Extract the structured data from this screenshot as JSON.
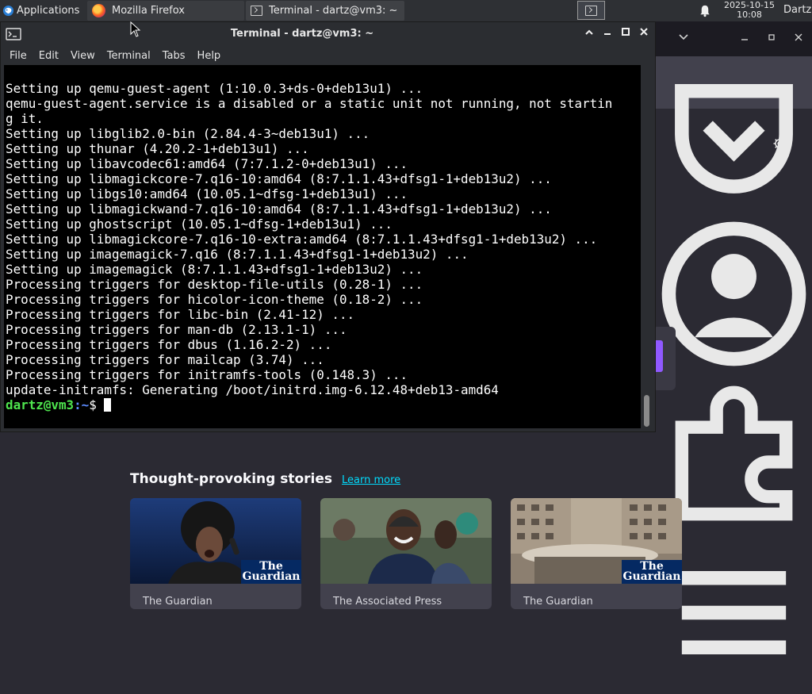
{
  "panel": {
    "applications_label": "Applications",
    "tasks": [
      {
        "label": "Mozilla Firefox",
        "icon": "firefox-icon"
      },
      {
        "label": "Terminal - dartz@vm3: ~",
        "icon": "terminal-icon"
      }
    ],
    "clock_date": "2025-10-15",
    "clock_time": "10:08",
    "user": "Dartz"
  },
  "terminal": {
    "title": "Terminal - dartz@vm3: ~",
    "menu": [
      "File",
      "Edit",
      "View",
      "Terminal",
      "Tabs",
      "Help"
    ],
    "output_lines": [
      "Setting up qemu-guest-agent (1:10.0.3+ds-0+deb13u1) ...",
      "qemu-guest-agent.service is a disabled or a static unit not running, not startin",
      "g it.",
      "Setting up libglib2.0-bin (2.84.4-3~deb13u1) ...",
      "Setting up thunar (4.20.2-1+deb13u1) ...",
      "Setting up libavcodec61:amd64 (7:7.1.2-0+deb13u1) ...",
      "Setting up libmagickcore-7.q16-10:amd64 (8:7.1.1.43+dfsg1-1+deb13u2) ...",
      "Setting up libgs10:amd64 (10.05.1~dfsg-1+deb13u1) ...",
      "Setting up libmagickwand-7.q16-10:amd64 (8:7.1.1.43+dfsg1-1+deb13u2) ...",
      "Setting up ghostscript (10.05.1~dfsg-1+deb13u1) ...",
      "Setting up libmagickcore-7.q16-10-extra:amd64 (8:7.1.1.43+dfsg1-1+deb13u2) ...",
      "Setting up imagemagick-7.q16 (8:7.1.1.43+dfsg1-1+deb13u2) ...",
      "Setting up imagemagick (8:7.1.1.43+dfsg1-1+deb13u2) ...",
      "Processing triggers for desktop-file-utils (0.28-1) ...",
      "Processing triggers for hicolor-icon-theme (0.18-2) ...",
      "Processing triggers for libc-bin (2.41-12) ...",
      "Processing triggers for man-db (2.13.1-1) ...",
      "Processing triggers for dbus (1.16.2-2) ...",
      "Processing triggers for mailcap (3.74) ...",
      "Processing triggers for initramfs-tools (0.148.3) ...",
      "update-initramfs: Generating /boot/initrd.img-6.12.48+deb13-amd64"
    ],
    "prompt_user": "dartz@vm3",
    "prompt_path": ":~",
    "prompt_symbol": "$ "
  },
  "firefox": {
    "stories_heading": "Thought-provoking stories",
    "learn_more": "Learn more",
    "stories": [
      {
        "source": "The Guardian",
        "badge": "The Guardian"
      },
      {
        "source": "The Associated Press"
      },
      {
        "source": "The Guardian",
        "badge": "The Guardian"
      }
    ]
  },
  "colors": {
    "terminal_bg": "#000000",
    "prompt_user": "#4ee44e",
    "prompt_path": "#5c8cff",
    "firefox_bg": "#2b2a33",
    "link": "#00ddff",
    "guardian_blue": "#052962"
  }
}
